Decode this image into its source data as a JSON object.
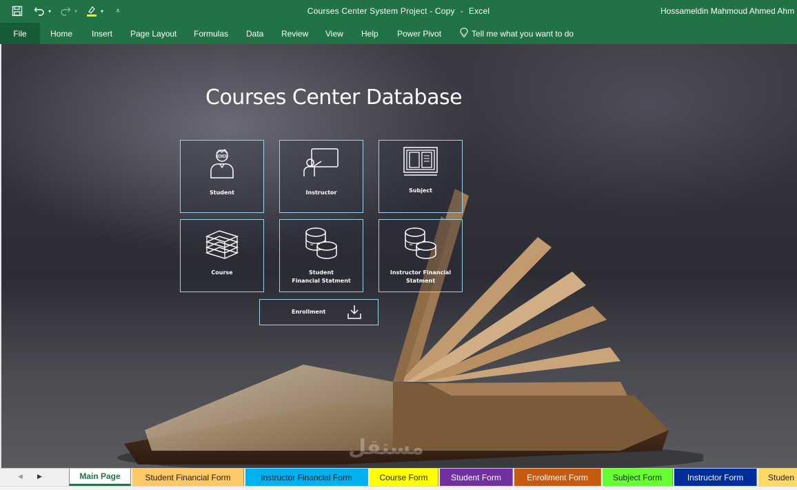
{
  "titlebar": {
    "document_title": "Courses Center System Project - Copy",
    "separator": "-",
    "app_name": "Excel",
    "user_name": "Hossameldin Mahmoud Ahmed Ahm",
    "icons": [
      "save-icon",
      "undo-icon",
      "redo-icon",
      "highlight-icon",
      "customize-icon"
    ]
  },
  "ribbon": {
    "file": "File",
    "tabs": [
      "Home",
      "Insert",
      "Page Layout",
      "Formulas",
      "Data",
      "Review",
      "View",
      "Help",
      "Power Pivot"
    ],
    "tell_me": "Tell me what you want to do"
  },
  "page": {
    "title": "Courses Center Database",
    "tiles": [
      {
        "label": "Student",
        "icon": "student-icon"
      },
      {
        "label": "Instructor",
        "icon": "instructor-icon"
      },
      {
        "label": "Subject",
        "icon": "subject-icon"
      },
      {
        "label": "Course",
        "icon": "books-stack-icon"
      },
      {
        "label_line1": "Student",
        "label_line2": "Financial Statment",
        "icon": "coins-icon"
      },
      {
        "label_line1": "Instructor Financial",
        "label_line2": "Statment",
        "icon": "coins-icon"
      }
    ],
    "enrollment": {
      "label": "Enrollment",
      "icon": "download-icon"
    },
    "watermark": "مستقل"
  },
  "sheet_tabs": [
    {
      "label": "Main Page",
      "color": "#ffffff"
    },
    {
      "label": "Student Financial Form",
      "color": "#ffc866"
    },
    {
      "label": "Instructor Financial Form",
      "color": "#00b0f0"
    },
    {
      "label": "Course Form",
      "color": "#ffff00"
    },
    {
      "label": "Student Form",
      "color": "#7030a0"
    },
    {
      "label": "Enrollment Form",
      "color": "#c55a11"
    },
    {
      "label": "Subject Form",
      "color": "#66ff33"
    },
    {
      "label": "Instructor Form",
      "color": "#002d9c"
    },
    {
      "label": "Studen",
      "color": "#ffd966"
    }
  ],
  "colors": {
    "accent": "#217346",
    "tile_border": "#9fd3e6"
  }
}
